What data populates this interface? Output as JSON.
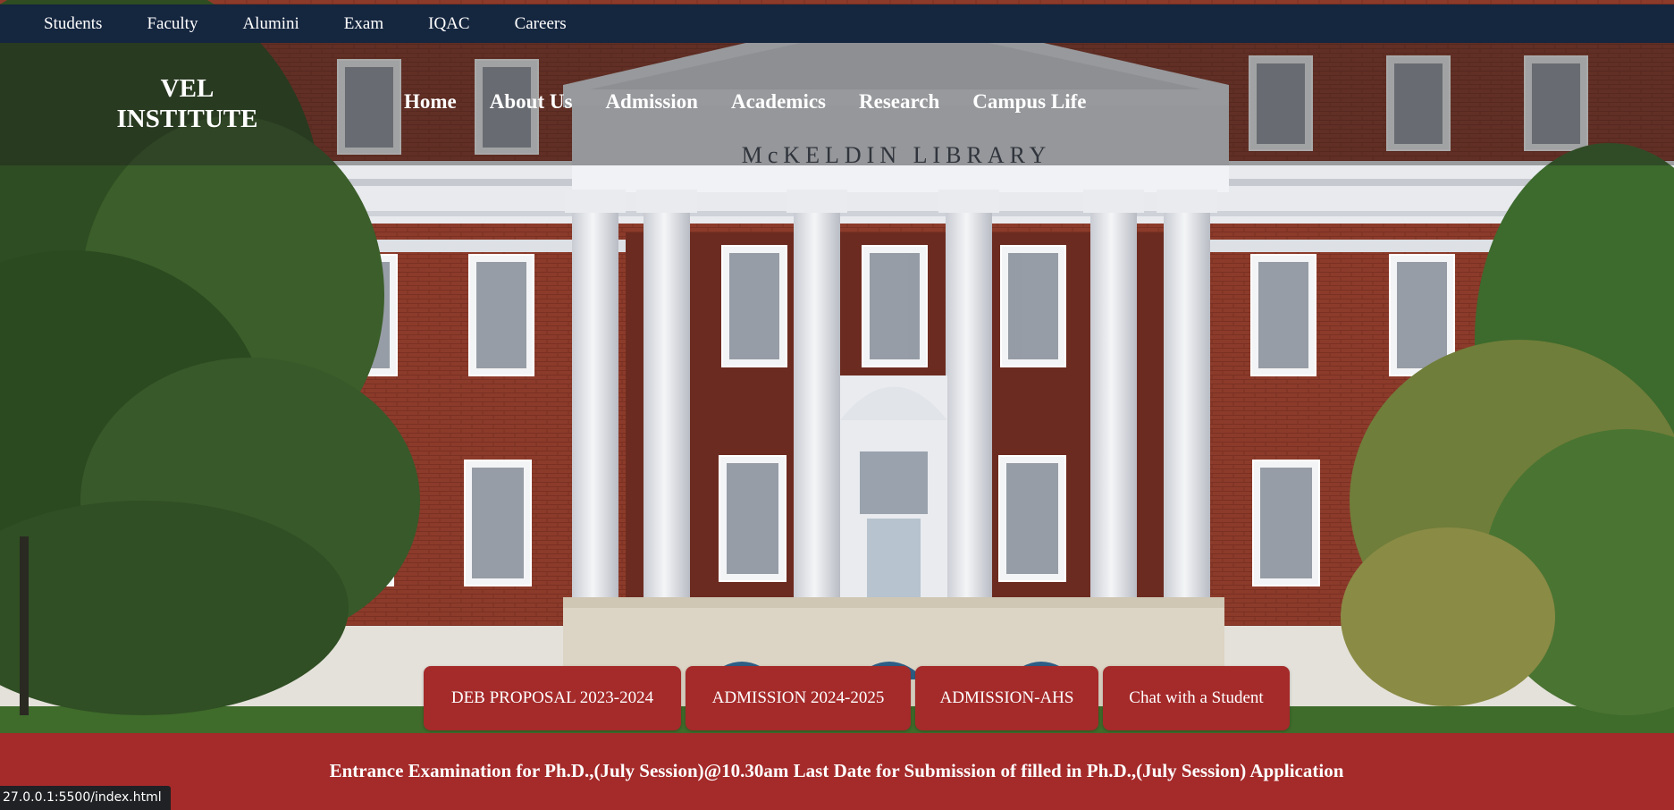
{
  "topbar": {
    "links": [
      {
        "label": "Students"
      },
      {
        "label": "Faculty"
      },
      {
        "label": "Alumini"
      },
      {
        "label": "Exam"
      },
      {
        "label": "IQAC"
      },
      {
        "label": "Careers"
      }
    ]
  },
  "header": {
    "brand_line1": "VEL",
    "brand_line2": "INSTITUTE",
    "nav": [
      {
        "label": "Home"
      },
      {
        "label": "About Us"
      },
      {
        "label": "Admission"
      },
      {
        "label": "Academics"
      },
      {
        "label": "Research"
      },
      {
        "label": "Campus Life"
      }
    ]
  },
  "hero": {
    "building_sign": "McKELDIN LIBRARY"
  },
  "cta_buttons": [
    {
      "label": "DEB PROPOSAL 2023-2024"
    },
    {
      "label": "ADMISSION 2024-2025"
    },
    {
      "label": "ADMISSION-AHS"
    },
    {
      "label": "Chat with a Student"
    }
  ],
  "announcement": {
    "text": "Entrance Examination for Ph.D.,(July Session)@10.30am Last Date for Submission of filled in Ph.D.,(July Session) Application"
  },
  "browser_status": {
    "url": "27.0.0.1:5500/index.html"
  },
  "colors": {
    "topbar_bg": "#15263f",
    "accent_red": "#a52a2a",
    "brick": "#8b3a2a",
    "stone": "#e9ecef"
  }
}
